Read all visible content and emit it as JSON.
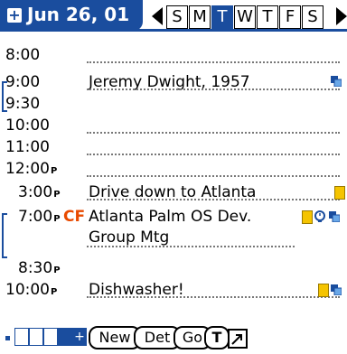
{
  "header": {
    "date": "Jun 26, 01",
    "days": [
      "S",
      "M",
      "T",
      "W",
      "T",
      "F",
      "S"
    ],
    "selected_day_index": 2
  },
  "schedule": [
    {
      "time": "8:00",
      "ampm": "",
      "description": ""
    },
    {
      "time": "9:00",
      "ampm": "",
      "description": "Jeremy Dwight, 1957"
    },
    {
      "time": "9:30",
      "ampm": "",
      "description": ""
    },
    {
      "time": "10:00",
      "ampm": "",
      "description": ""
    },
    {
      "time": "11:00",
      "ampm": "",
      "description": ""
    },
    {
      "time": "12:00",
      "ampm": "P",
      "description": ""
    },
    {
      "time": "3:00",
      "ampm": "P",
      "description": "Drive down to Atlanta"
    },
    {
      "time": "7:00",
      "ampm": "P",
      "description": "Atlanta Palm OS Dev. Group Mtg",
      "badge": "CF"
    },
    {
      "time": "8:30",
      "ampm": "P",
      "description": ""
    },
    {
      "time": "10:00",
      "ampm": "P",
      "description": "Dishwasher!"
    }
  ],
  "toolbar": {
    "new_label": "New",
    "details_label": "Det",
    "goto_label": "Go",
    "t_label": "T"
  },
  "colors": {
    "accent": "#1a4d9e",
    "note": "#f5c400",
    "badge": "#e84a00"
  }
}
